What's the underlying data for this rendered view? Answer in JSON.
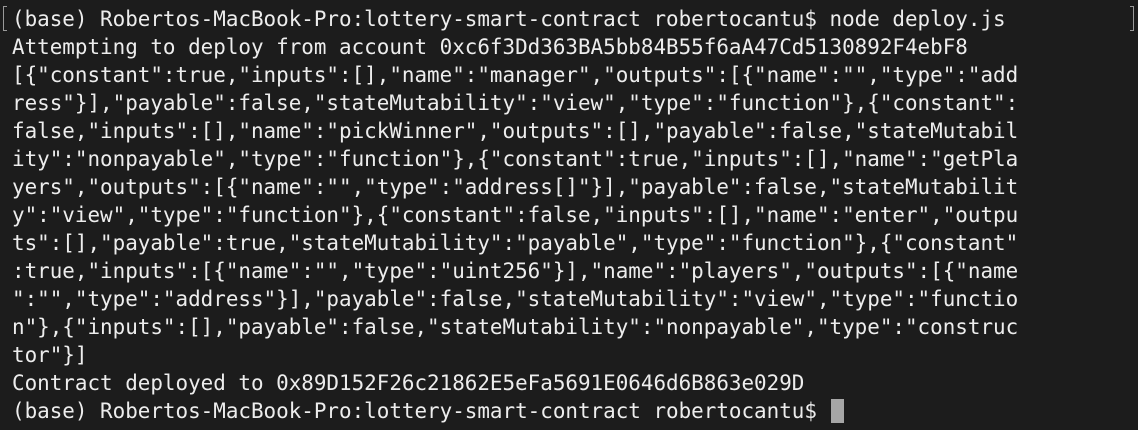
{
  "terminal": {
    "lines": [
      "(base) Robertos-MacBook-Pro:lottery-smart-contract robertocantu$ node deploy.js",
      "Attempting to deploy from account 0xc6f3Dd363BA5bb84B55f6aA47Cd5130892F4ebF8",
      "[{\"constant\":true,\"inputs\":[],\"name\":\"manager\",\"outputs\":[{\"name\":\"\",\"type\":\"add",
      "ress\"}],\"payable\":false,\"stateMutability\":\"view\",\"type\":\"function\"},{\"constant\":",
      "false,\"inputs\":[],\"name\":\"pickWinner\",\"outputs\":[],\"payable\":false,\"stateMutabil",
      "ity\":\"nonpayable\",\"type\":\"function\"},{\"constant\":true,\"inputs\":[],\"name\":\"getPla",
      "yers\",\"outputs\":[{\"name\":\"\",\"type\":\"address[]\"}],\"payable\":false,\"stateMutabilit",
      "y\":\"view\",\"type\":\"function\"},{\"constant\":false,\"inputs\":[],\"name\":\"enter\",\"outpu",
      "ts\":[],\"payable\":true,\"stateMutability\":\"payable\",\"type\":\"function\"},{\"constant\"",
      ":true,\"inputs\":[{\"name\":\"\",\"type\":\"uint256\"}],\"name\":\"players\",\"outputs\":[{\"name",
      "\":\"\",\"type\":\"address\"}],\"payable\":false,\"stateMutability\":\"view\",\"type\":\"functio",
      "n\"},{\"inputs\":[],\"payable\":false,\"stateMutability\":\"nonpayable\",\"type\":\"construc",
      "tor\"}]",
      "Contract deployed to 0x89D152F26c21862E5eFa5691E0646d6B863e029D"
    ],
    "prompt": "(base) Robertos-MacBook-Pro:lottery-smart-contract robertocantu$ "
  }
}
